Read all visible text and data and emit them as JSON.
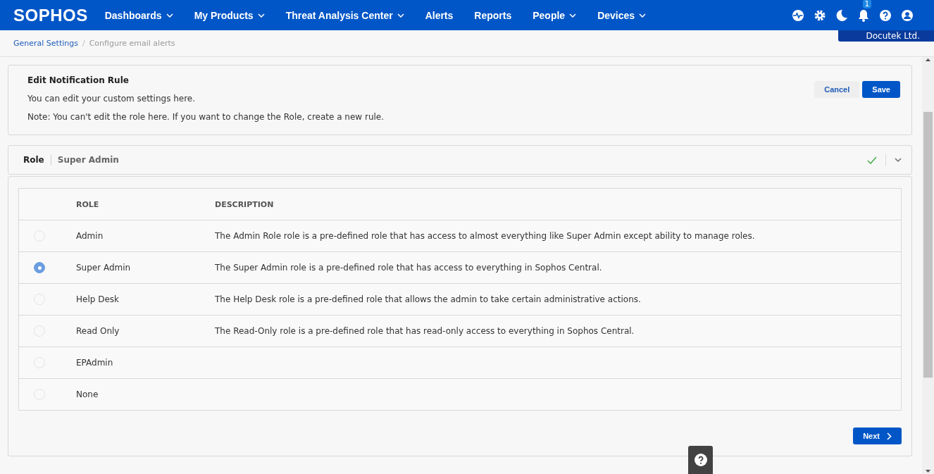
{
  "brand": "SOPHOS",
  "nav": [
    {
      "label": "Dashboards",
      "has_menu": true
    },
    {
      "label": "My Products",
      "has_menu": true
    },
    {
      "label": "Threat Analysis Center",
      "has_menu": true
    },
    {
      "label": "Alerts",
      "has_menu": false
    },
    {
      "label": "Reports",
      "has_menu": false
    },
    {
      "label": "People",
      "has_menu": true
    },
    {
      "label": "Devices",
      "has_menu": true
    }
  ],
  "notification_count": "1",
  "tenant": "Docutek Ltd.",
  "breadcrumb_separator": "/",
  "breadcrumb": [
    {
      "label": "General Settings",
      "kind": "link"
    },
    {
      "label": "Configure email alerts",
      "kind": "current"
    }
  ],
  "header": {
    "title": "Edit Notification Rule",
    "text": "You can edit your custom settings here.",
    "note": "Note: You can't edit the role here. If you want to change the Role, create a new rule.",
    "buttons": [
      {
        "label": "Cancel",
        "kind": "secondary"
      },
      {
        "label": "Save",
        "kind": "primary"
      }
    ]
  },
  "section": {
    "label": "Role",
    "value": "Super Admin",
    "complete": true,
    "expanded": true
  },
  "table": {
    "columns": [
      "ROLE",
      "DESCRIPTION"
    ],
    "rows": [
      {
        "role": "Admin",
        "description": "The Admin Role role is a pre-defined role that has access to almost everything like Super Admin except ability to manage roles.",
        "selected": false
      },
      {
        "role": "Super Admin",
        "description": "The Super Admin role is a pre-defined role that has access to everything in Sophos Central.",
        "selected": true
      },
      {
        "role": "Help Desk",
        "description": "The Help Desk role is a pre-defined role that allows the admin to take certain administrative actions.",
        "selected": false
      },
      {
        "role": "Read Only",
        "description": "The Read-Only role is a pre-defined role that has read-only access to everything in Sophos Central.",
        "selected": false
      },
      {
        "role": "EPAdmin",
        "selected": false
      },
      {
        "role": "None",
        "selected": false
      }
    ]
  },
  "next_button": "Next"
}
